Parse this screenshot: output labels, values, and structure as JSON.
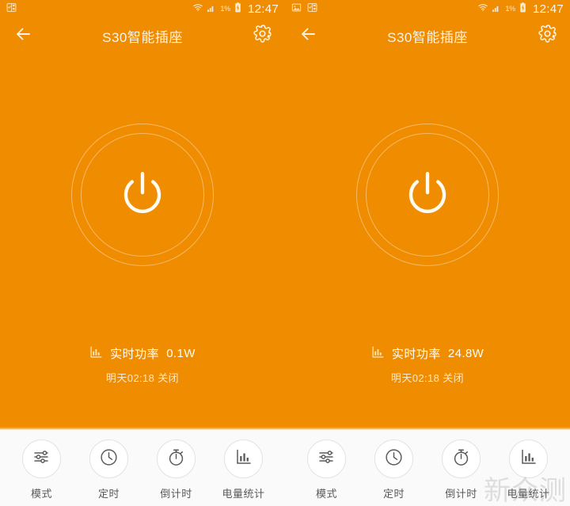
{
  "colors": {
    "background": "#F08C00",
    "toolbar_background": "#FAFAFA",
    "title_text": "#FFF3E0",
    "ring_stroke": "rgba(255,255,255,0.40)",
    "tool_label": "#5A5A5A"
  },
  "screens": [
    {
      "statusbar": {
        "left_icons": [
          "task-checklist-icon"
        ],
        "wifi_icon": "wifi-icon",
        "signal_icon": "cellular-signal-icon",
        "battery_percent": "1%",
        "battery_icon": "battery-charging-icon",
        "clock": "12:47"
      },
      "appbar": {
        "back_icon": "back-arrow-icon",
        "title": "S30智能插座",
        "settings_icon": "gear-icon"
      },
      "power_button": {
        "icon": "power-icon",
        "state": "on"
      },
      "power_info": {
        "chart_icon": "bar-chart-icon",
        "label": "实时功率",
        "value": "0.1W",
        "schedule": "明天02:18 关闭"
      },
      "toolbar": [
        {
          "icon": "sliders-icon",
          "label": "模式"
        },
        {
          "icon": "clock-icon",
          "label": "定时"
        },
        {
          "icon": "stopwatch-icon",
          "label": "倒计时"
        },
        {
          "icon": "bar-chart-icon",
          "label": "电量统计"
        }
      ],
      "watermark": ""
    },
    {
      "statusbar": {
        "left_icons": [
          "image-icon",
          "task-checklist-icon"
        ],
        "wifi_icon": "wifi-icon",
        "signal_icon": "cellular-signal-icon",
        "battery_percent": "1%",
        "battery_icon": "battery-charging-icon",
        "clock": "12:47"
      },
      "appbar": {
        "back_icon": "back-arrow-icon",
        "title": "S30智能插座",
        "settings_icon": "gear-icon"
      },
      "power_button": {
        "icon": "power-icon",
        "state": "on"
      },
      "power_info": {
        "chart_icon": "bar-chart-icon",
        "label": "实时功率",
        "value": "24.8W",
        "schedule": "明天02:18 关闭"
      },
      "toolbar": [
        {
          "icon": "sliders-icon",
          "label": "模式"
        },
        {
          "icon": "clock-icon",
          "label": "定时"
        },
        {
          "icon": "stopwatch-icon",
          "label": "倒计时"
        },
        {
          "icon": "bar-chart-icon",
          "label": "电量统计"
        }
      ],
      "watermark": "新众测"
    }
  ]
}
